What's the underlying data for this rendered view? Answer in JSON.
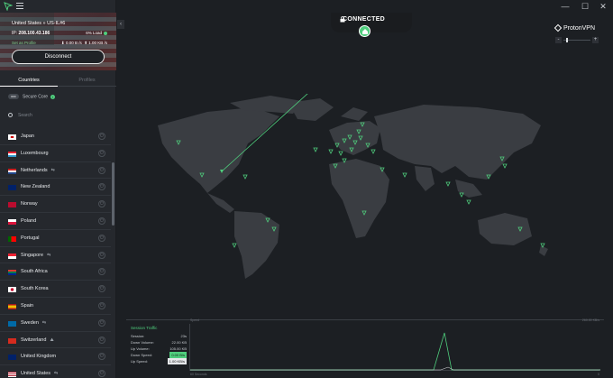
{
  "window": {
    "minimize": "—",
    "maximize": "☐",
    "close": "✕"
  },
  "connection": {
    "server": "United States » US-IL#6",
    "ip_label": "IP:",
    "ip": "208.100.43.186",
    "load": "6% Load",
    "safe": "Set as Profile",
    "down_speed": "0.00 B /s",
    "up_speed": "1.00 KB /s",
    "disconnect": "Disconnect",
    "status": "CONNECTED"
  },
  "tabs": {
    "countries": "Countries",
    "profiles": "Profiles"
  },
  "secure_core": {
    "toggle": "OFF",
    "label": "Secure Core"
  },
  "search": {
    "placeholder": "Search"
  },
  "countries": [
    {
      "name": "Japan",
      "feature": ""
    },
    {
      "name": "Luxembourg",
      "feature": ""
    },
    {
      "name": "Netherlands",
      "feature": "⇆"
    },
    {
      "name": "New Zealand",
      "feature": ""
    },
    {
      "name": "Norway",
      "feature": ""
    },
    {
      "name": "Poland",
      "feature": ""
    },
    {
      "name": "Portugal",
      "feature": ""
    },
    {
      "name": "Singapore",
      "feature": "⇆"
    },
    {
      "name": "South Africa",
      "feature": ""
    },
    {
      "name": "South Korea",
      "feature": ""
    },
    {
      "name": "Spain",
      "feature": ""
    },
    {
      "name": "Sweden",
      "feature": "⇆"
    },
    {
      "name": "Switzerland",
      "feature": "⛰"
    },
    {
      "name": "United Kingdom",
      "feature": ""
    },
    {
      "name": "United States",
      "feature": "⇆"
    }
  ],
  "brand": "ProtonVPN",
  "zoom": {
    "minus": "-",
    "plus": "+"
  },
  "traffic": {
    "title": "Session Traffic",
    "session_label": "Session:",
    "session": "23s",
    "down_volume_label": "Down Volume:",
    "down_volume": "22.00 KB",
    "up_volume_label": "Up Volume:",
    "up_volume": "105.00 KB",
    "down_speed_label": "Down Speed:",
    "down_speed": "0.00 B/s",
    "up_speed_label": "Up Speed:",
    "up_speed": "1.00 KB/s",
    "graph_top_left": "Speed",
    "graph_top_right": "260.00 KB/s",
    "graph_bottom_left": "60 Seconds",
    "graph_bottom_right": "0"
  },
  "colors": {
    "accent": "#4fce7d",
    "background": "#1c1f23",
    "sidebar": "#25282d",
    "map_land": "#3a3d42"
  }
}
